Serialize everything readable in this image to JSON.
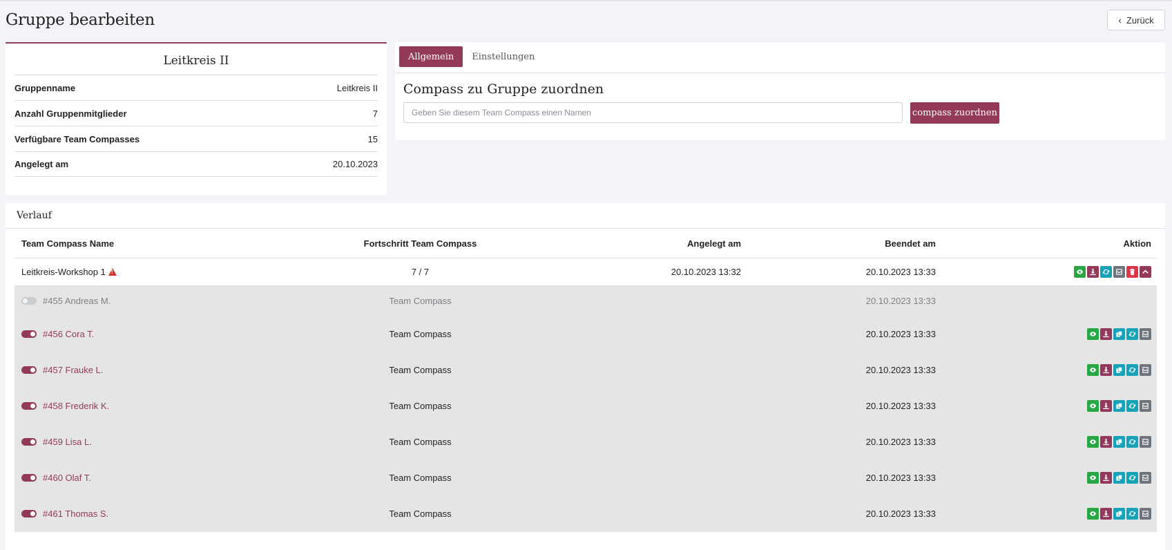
{
  "page": {
    "title": "Gruppe bearbeiten",
    "back_label": "Zurück"
  },
  "info": {
    "title": "Leitkreis II",
    "rows": [
      {
        "label": "Gruppenname",
        "value": "Leitkreis II"
      },
      {
        "label": "Anzahl Gruppenmitglieder",
        "value": "7"
      },
      {
        "label": "Verfügbare Team Compasses",
        "value": "15"
      },
      {
        "label": "Angelegt am",
        "value": "20.10.2023"
      }
    ]
  },
  "tabs": [
    {
      "label": "Allgemein",
      "active": true
    },
    {
      "label": "Einstellungen",
      "active": false
    }
  ],
  "assign": {
    "title": "Compass zu Gruppe zuordnen",
    "placeholder": "Geben Sie diesem Team Compass einen Namen",
    "button_label": "compass zuordnen"
  },
  "verlauf": {
    "title": "Verlauf",
    "columns": [
      "Team Compass Name",
      "Fortschritt Team Compass",
      "Angelegt am",
      "Beendet am",
      "Aktion"
    ],
    "main_row": {
      "name": "Leitkreis-Workshop 1",
      "progress": "7 / 7",
      "created": "20.10.2023 13:32",
      "finished": "20.10.2023 13:33"
    },
    "members": [
      {
        "label": "#455 Andreas M.",
        "type": "Team Compass",
        "finished": "20.10.2023 13:33",
        "enabled": false
      },
      {
        "label": "#456 Cora T.",
        "type": "Team Compass",
        "finished": "20.10.2023 13:33",
        "enabled": true
      },
      {
        "label": "#457 Frauke L.",
        "type": "Team Compass",
        "finished": "20.10.2023 13:33",
        "enabled": true
      },
      {
        "label": "#458 Frederik K.",
        "type": "Team Compass",
        "finished": "20.10.2023 13:33",
        "enabled": true
      },
      {
        "label": "#459 Lisa L.",
        "type": "Team Compass",
        "finished": "20.10.2023 13:33",
        "enabled": true
      },
      {
        "label": "#460 Olaf T.",
        "type": "Team Compass",
        "finished": "20.10.2023 13:33",
        "enabled": true
      },
      {
        "label": "#461 Thomas S.",
        "type": "Team Compass",
        "finished": "20.10.2023 13:33",
        "enabled": true
      }
    ]
  },
  "colors": {
    "brand": "#933a5b",
    "green": "#28a745",
    "cyan": "#17a2b8",
    "gray": "#6c757d",
    "danger": "#dc3545"
  },
  "icons": {
    "main_actions": [
      "eye-icon",
      "download-icon",
      "refresh-icon",
      "archive-icon",
      "trash-icon",
      "chevron-up-icon"
    ],
    "member_actions": [
      "eye-icon",
      "download-icon",
      "copy-icon",
      "refresh-icon",
      "archive-icon"
    ]
  }
}
